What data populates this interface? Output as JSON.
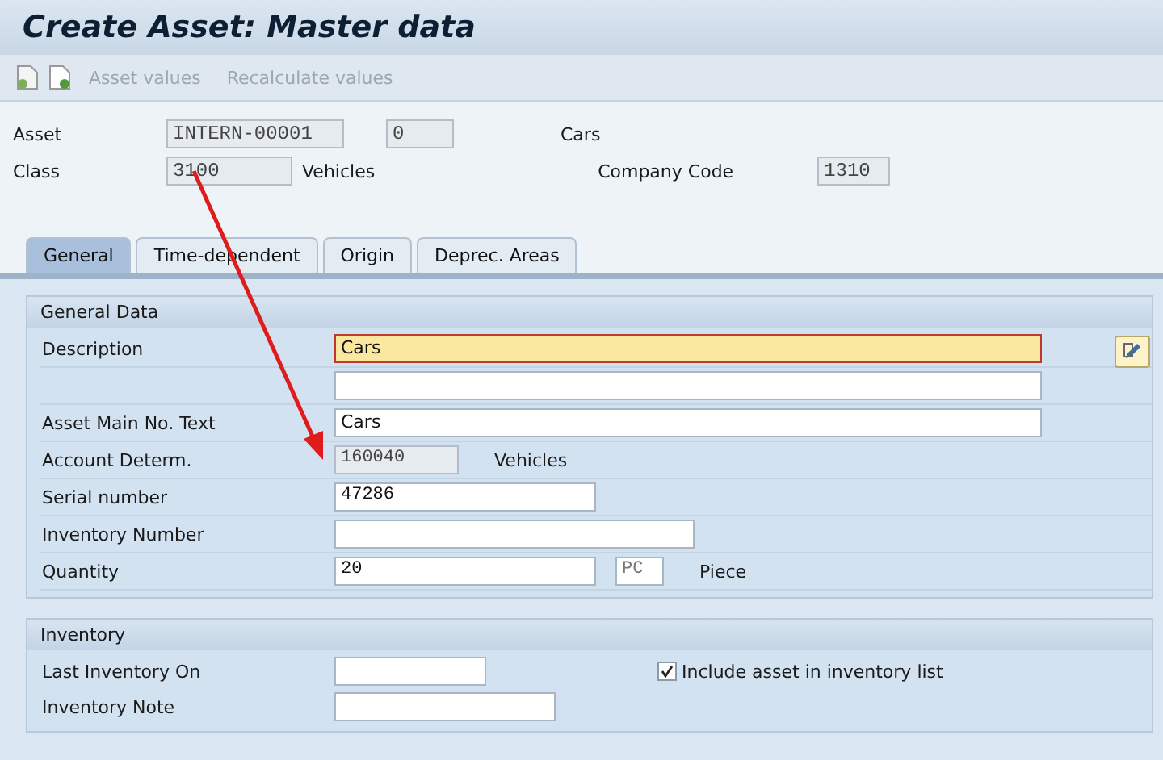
{
  "window": {
    "title": "Create Asset:  Master data"
  },
  "toolbar": {
    "buttons": [
      {
        "label": "Asset values",
        "disabled": true
      },
      {
        "label": "Recalculate values",
        "disabled": true
      }
    ]
  },
  "header": {
    "asset": {
      "label": "Asset",
      "number": "INTERN-00001",
      "sub_number": "0",
      "description": "Cars"
    },
    "class": {
      "label": "Class",
      "value": "3100",
      "description": "Vehicles"
    },
    "company_code": {
      "label": "Company Code",
      "value": "1310"
    }
  },
  "tabs": [
    {
      "label": "General",
      "selected": true
    },
    {
      "label": "Time-dependent",
      "selected": false
    },
    {
      "label": "Origin",
      "selected": false
    },
    {
      "label": "Deprec. Areas",
      "selected": false
    }
  ],
  "general_data": {
    "title": "General Data",
    "rows": [
      {
        "label": "Description",
        "value": "Cars",
        "editable": true,
        "focused": true
      },
      {
        "value": "",
        "editable": true,
        "focused": false
      },
      {
        "label": "Asset Main No. Text",
        "value": "Cars",
        "editable": true,
        "focused": false
      },
      {
        "label": "Account Determ.",
        "value": "160040",
        "editable": false,
        "focused": false,
        "description": "Vehicles"
      },
      {
        "label": "Serial number",
        "value": "47286",
        "editable": true,
        "focused": false
      },
      {
        "label": "Inventory Number",
        "value": "",
        "editable": true,
        "focused": false
      },
      {
        "label": "Quantity",
        "value": "20",
        "editable": true,
        "focused": false,
        "unit": "PC",
        "description": "Piece"
      }
    ]
  },
  "inventory": {
    "title": "Inventory",
    "rows": [
      {
        "label": "Last Inventory On",
        "value": ""
      },
      {
        "label": "Inventory Note",
        "value": ""
      }
    ],
    "checkbox": {
      "label": "Include asset in inventory list",
      "checked": true
    }
  }
}
